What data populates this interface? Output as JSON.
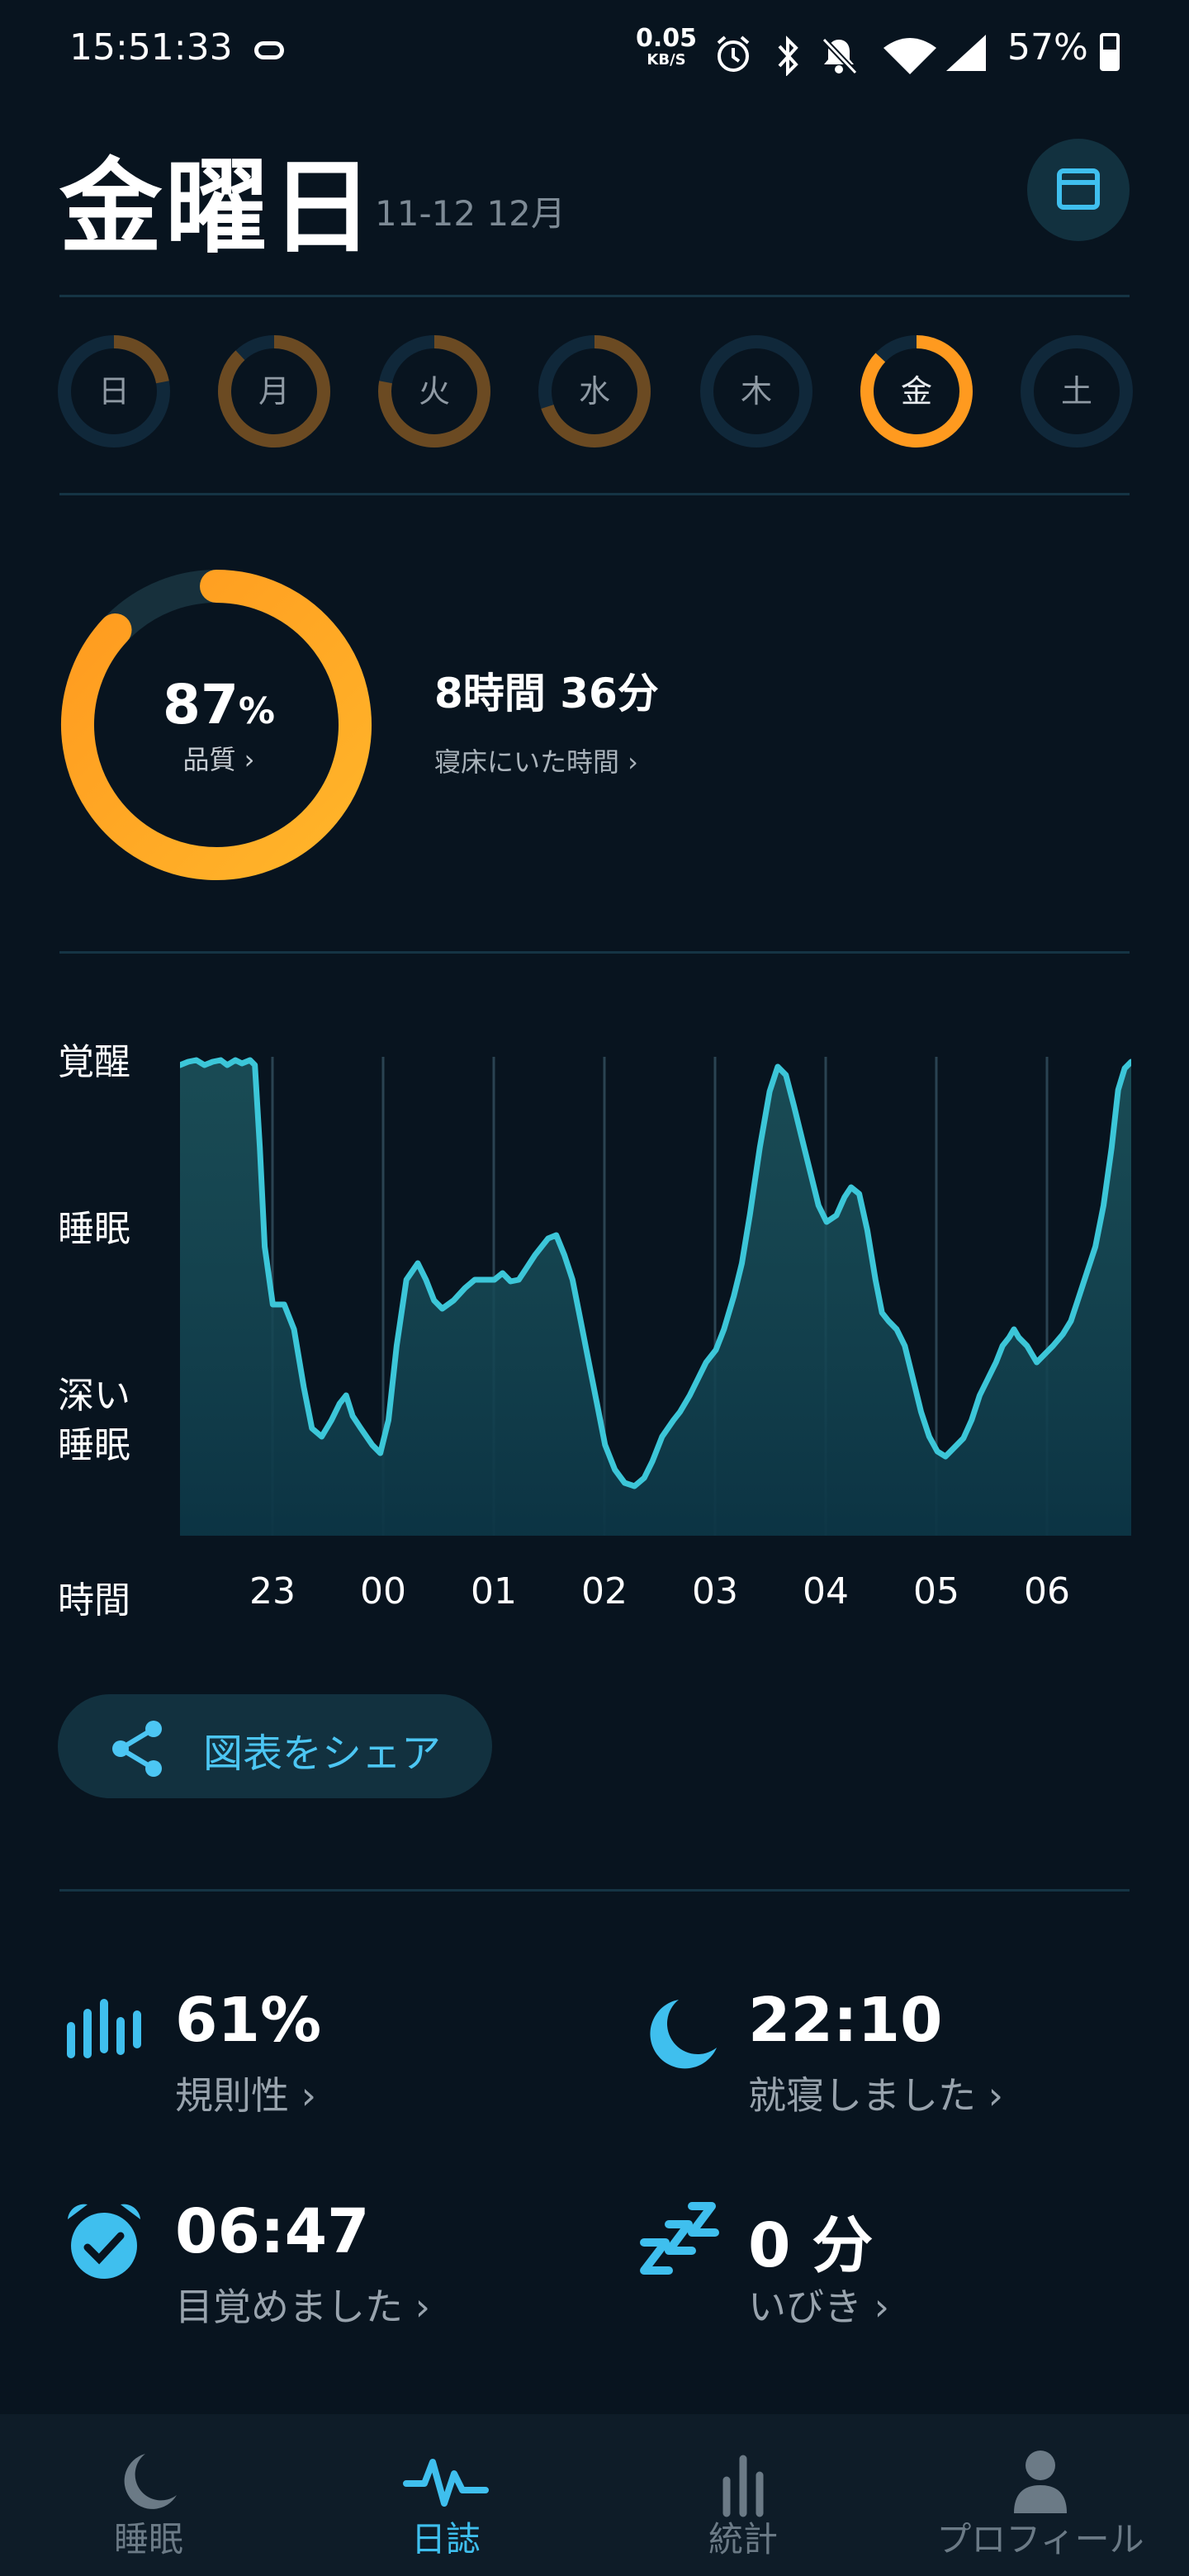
{
  "status_bar": {
    "time": "15:51:33",
    "speed_value": "0.05",
    "speed_unit": "KB/S",
    "icons": [
      "alarm-icon",
      "bluetooth-icon",
      "bell-off-icon",
      "wifi-icon",
      "signal-icon"
    ],
    "battery": "57%",
    "battery_level": 0.57
  },
  "header": {
    "day": "金曜日",
    "date_range": "11-12 12月"
  },
  "week": {
    "days": [
      {
        "label": "日",
        "fill": 0.22,
        "color": "#6b4a22"
      },
      {
        "label": "月",
        "fill": 0.88,
        "color": "#6b4a22"
      },
      {
        "label": "火",
        "fill": 0.78,
        "color": "#6b4a22"
      },
      {
        "label": "水",
        "fill": 0.7,
        "color": "#6b4a22"
      },
      {
        "label": "木",
        "fill": 0.0,
        "color": "#6b4a22"
      },
      {
        "label": "金",
        "fill": 0.87,
        "color": "#ff9a1f"
      },
      {
        "label": "土",
        "fill": 0.0,
        "color": "#6b4a22"
      }
    ],
    "selected": "金"
  },
  "summary": {
    "quality_value": "87",
    "quality_unit": "%",
    "quality_fraction": 0.87,
    "quality_label": "品質 ›",
    "duration": "8時間 36分",
    "in_bed_label": "寝床にいた時間 ›"
  },
  "graph": {
    "y_labels": [
      "覚醒",
      "睡眠",
      "深い",
      "睡眠"
    ],
    "x_axis_label": "時間",
    "x_labels": [
      "23",
      "00",
      "01",
      "02",
      "03",
      "04",
      "05",
      "06"
    ],
    "accent": "#3cc6d8"
  },
  "share": {
    "label": "図表をシェア"
  },
  "stats": {
    "regularity_value": "61%",
    "regularity_label": "規則性 ›",
    "bedtime_value": "22:10",
    "bedtime_label": "就寝しました ›",
    "wake_value": "06:47",
    "wake_label": "目覚めました ›",
    "snore_value": "0 分",
    "snore_label": "いびき ›",
    "icon_color": "#3fbfee"
  },
  "nav": {
    "items": [
      {
        "label": "睡眠",
        "icon": "moon-icon"
      },
      {
        "label": "日誌",
        "icon": "pulse-icon"
      },
      {
        "label": "統計",
        "icon": "bar-chart-icon"
      },
      {
        "label": "プロフィール",
        "icon": "profile-icon"
      }
    ],
    "active": "日誌"
  }
}
